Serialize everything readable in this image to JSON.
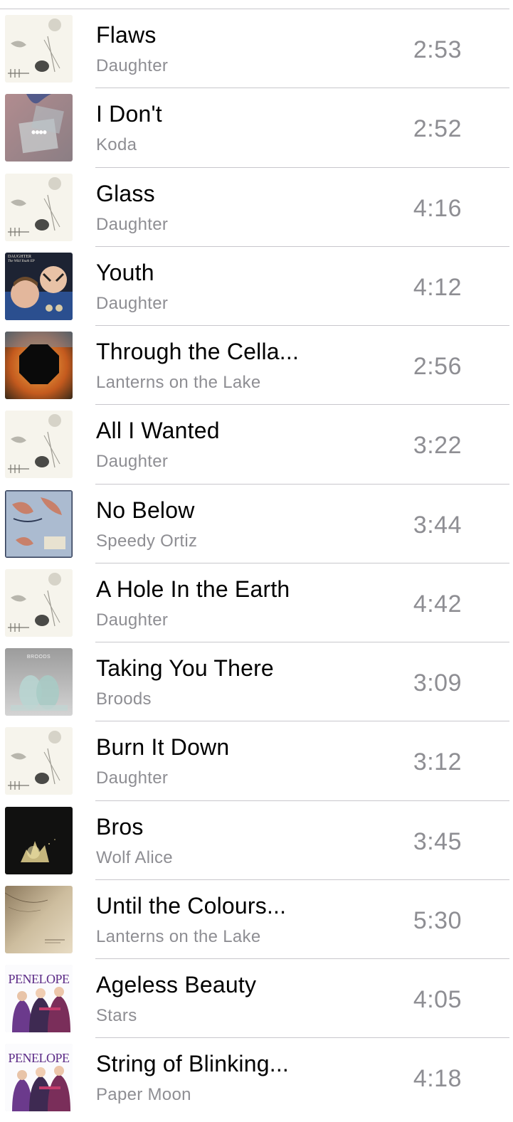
{
  "songs": [
    {
      "title": "Flaws",
      "artist": "Daughter",
      "duration": "2:53",
      "art": "album-daughter-if-youre-leaving"
    },
    {
      "title": "I Don't",
      "artist": "Koda",
      "duration": "2:52",
      "art": "album-koda",
      "art_badge": "••••"
    },
    {
      "title": "Glass",
      "artist": "Daughter",
      "duration": "4:16",
      "art": "album-daughter-if-youre-leaving"
    },
    {
      "title": "Youth",
      "artist": "Daughter",
      "duration": "4:12",
      "art": "album-daughter-the-wild-youth",
      "art_text": "DAUGHTER",
      "art_subtext": "The Wild Youth EP"
    },
    {
      "title": "Through the Cella...",
      "artist": "Lanterns on the Lake",
      "duration": "2:56",
      "art": "album-lanterns-octagon"
    },
    {
      "title": "All I Wanted",
      "artist": "Daughter",
      "duration": "3:22",
      "art": "album-daughter-if-youre-leaving"
    },
    {
      "title": "No Below",
      "artist": "Speedy Ortiz",
      "duration": "3:44",
      "art": "album-speedy-ortiz"
    },
    {
      "title": "A Hole In the Earth",
      "artist": "Daughter",
      "duration": "4:42",
      "art": "album-daughter-if-youre-leaving"
    },
    {
      "title": "Taking You There",
      "artist": "Broods",
      "duration": "3:09",
      "art": "album-broods",
      "art_text": "BROODS"
    },
    {
      "title": "Burn It Down",
      "artist": "Daughter",
      "duration": "3:12",
      "art": "album-daughter-if-youre-leaving"
    },
    {
      "title": "Bros",
      "artist": "Wolf Alice",
      "duration": "3:45",
      "art": "album-wolf-alice"
    },
    {
      "title": "Until the Colours...",
      "artist": "Lanterns on the Lake",
      "duration": "5:30",
      "art": "album-lanterns-sand"
    },
    {
      "title": "Ageless Beauty",
      "artist": "Stars",
      "duration": "4:05",
      "art": "album-penelope-soundtrack",
      "art_text": "PENELOPE"
    },
    {
      "title": "String of Blinking...",
      "artist": "Paper Moon",
      "duration": "4:18",
      "art": "album-penelope-soundtrack",
      "art_text": "PENELOPE"
    }
  ],
  "colors": {
    "title": "#000000",
    "secondary": "#8e8e93",
    "separator": "#c8c7cc",
    "background": "#ffffff"
  }
}
